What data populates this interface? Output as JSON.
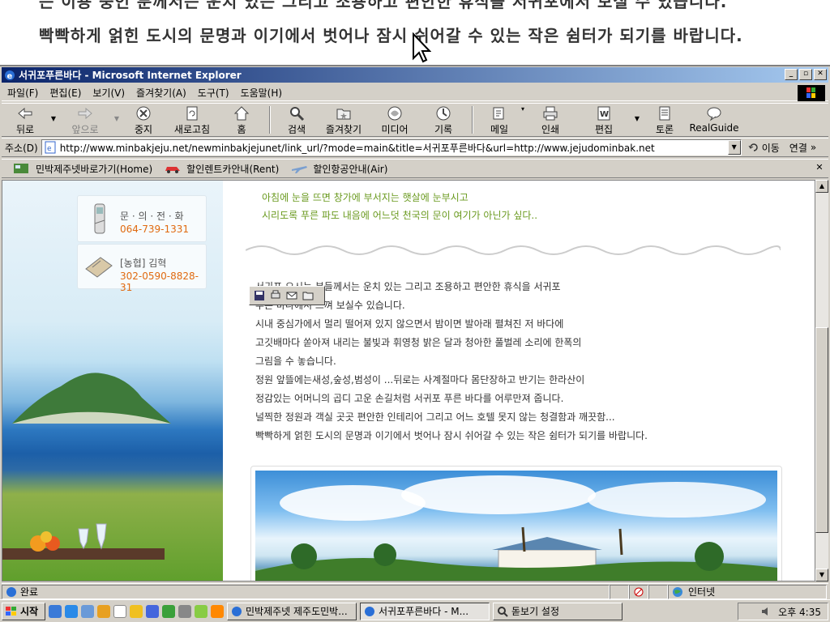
{
  "magnifier": {
    "top_line": "는 이용 중인 분께서는 운치 있는 그리고 조용하고 편안한 휴식을 서귀포에서 보실 수 있습니다.",
    "main_line": "빡빡하게 얽힌 도시의 문명과 이기에서 벗어나 잠시 쉬어갈 수 있는 작은 쉼터가 되기를 바랍니다."
  },
  "window": {
    "title": "서귀포푸른바다 - Microsoft Internet Explorer"
  },
  "menu": {
    "items": [
      "파일(F)",
      "편집(E)",
      "보기(V)",
      "즐겨찾기(A)",
      "도구(T)",
      "도움말(H)"
    ]
  },
  "toolbar": {
    "back": "뒤로",
    "forward": "앞으로",
    "stop": "중지",
    "refresh": "새로고침",
    "home": "홈",
    "search": "검색",
    "favorites": "즐겨찾기",
    "media": "미디어",
    "history": "기록",
    "mail": "메일",
    "print": "인쇄",
    "edit": "편집",
    "discuss": "토론",
    "realguide": "RealGuide"
  },
  "address": {
    "label": "주소(D)",
    "url": "http://www.minbakjeju.net/newminbakjejunet/link_url/?mode=main&title=서귀포푸른바다&url=http://www.jejudominbak.net",
    "go": "이동",
    "links": "연결"
  },
  "links_bar": {
    "items": [
      "민박제주넷바로가기(Home)",
      "할인렌트카안내(Rent)",
      "할인항공안내(Air)"
    ]
  },
  "sidebar": {
    "contact_title": "문 · 의 · 전 · 화",
    "contact_phone": "064-739-1331",
    "bank_title": "[농협] 김혁",
    "bank_account": "302-0590-8828-31"
  },
  "content": {
    "quote_lines": [
      "아침에 눈을 뜨면 창가에 부서지는 햇살에 눈부시고",
      "시리도록 푸른 파도 내음에 어느덧 천국의 문이 여기가 아닌가 싶다.."
    ],
    "body_lines": [
      "서귀포 오시는 분들께서는  운치 있는 그리고 조용하고 편안한 휴식을 서귀포",
      "푸른 바다에서 느껴 보실수 있습니다.",
      "시내 중심가에서 멀리 떨어져 있지 않으면서 밤이면 발아래 펼쳐진 저 바다에",
      "고깃배마다 쏟아져 내리는 불빛과 휘영청 밝은 달과 청아한 풀벌레 소리에 한폭의",
      "그림을 수 놓습니다.",
      "정원 앞뜰에는새성,숲성,범성이 ...뒤로는 사계절마다 몸단장하고 반기는 한라산이",
      "정감있는 어머니의 곱디 고운 손길처럼 서귀포 푸른 바다를 어루만져 줍니다.",
      "널찍한 정원과 객실 곳곳 편안한 인테리어 그리고 어느 호텔 못지 않는 청결함과 깨끗함...",
      "빡빡하게 얽힌 도시의 문명과 이기에서 벗어나 잠시 쉬어갈 수 있는 작은 쉼터가 되기를 바랍니다."
    ]
  },
  "status": {
    "text": "완료",
    "zone": "인터넷"
  },
  "taskbar": {
    "start": "시작",
    "tasks": [
      "민박제주넷 제주도민박...",
      "서귀포푸른바다 - M...",
      "돋보기 설정"
    ],
    "clock": "오후 4:35"
  }
}
